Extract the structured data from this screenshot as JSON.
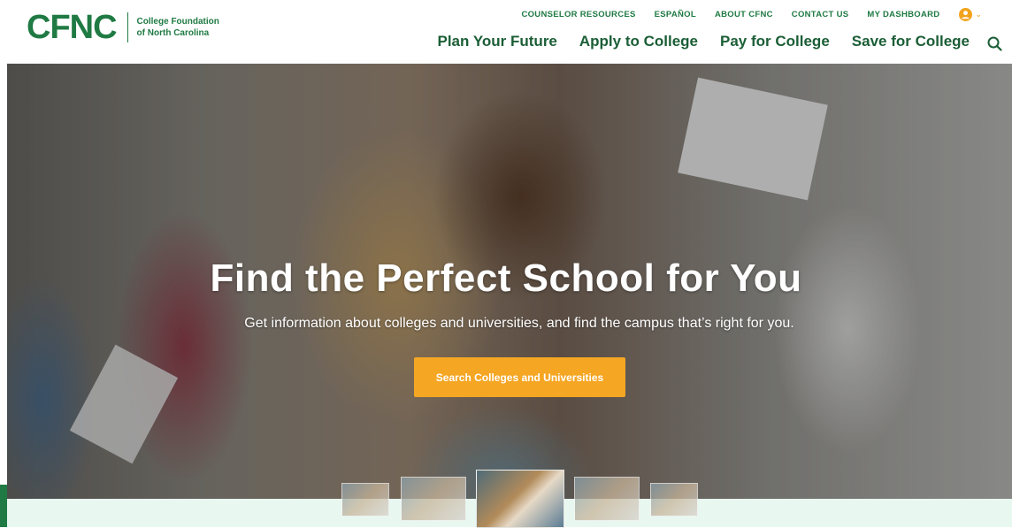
{
  "header": {
    "logo_mark": "CFNC",
    "logo_line1": "College Foundation",
    "logo_line2": "of North Carolina",
    "utility_links": [
      "COUNSELOR RESOURCES",
      "ESPAÑOL",
      "ABOUT CFNC",
      "CONTACT US",
      "MY DASHBOARD"
    ],
    "main_nav": [
      "Plan Your Future",
      "Apply to College",
      "Pay for College",
      "Save for College"
    ],
    "icons": {
      "user": "user-circle-icon",
      "caret": "chevron-down-icon",
      "search": "search-icon"
    }
  },
  "hero": {
    "title": "Find the Perfect School for You",
    "subtitle": "Get information about colleges and universities, and find the campus that’s right for you.",
    "cta_label": "Search Colleges and Universities"
  },
  "carousel": {
    "slide_count": 5,
    "active_index": 2
  },
  "colors": {
    "brand_green": "#1f7a43",
    "nav_green": "#1b5e36",
    "accent_orange": "#f5a623",
    "strip_mint": "#e8f8f1"
  }
}
